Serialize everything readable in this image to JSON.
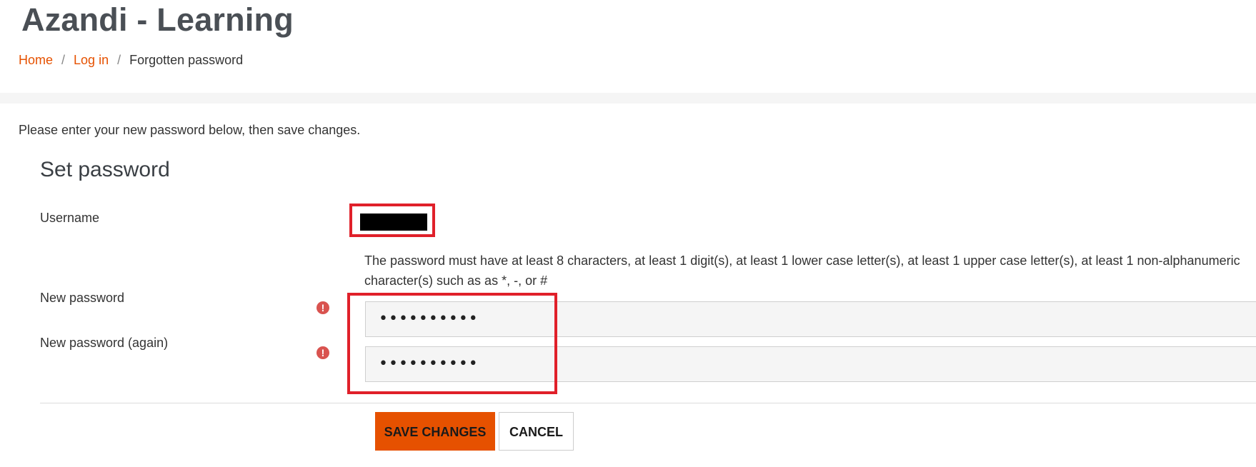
{
  "site": {
    "title": "Azandi - Learning"
  },
  "breadcrumb": {
    "items": [
      {
        "label": "Home"
      },
      {
        "label": "Log in"
      },
      {
        "label": "Forgotten password"
      }
    ],
    "separator": "/"
  },
  "form": {
    "intro": "Please enter your new password below, then save changes.",
    "legend": "Set password",
    "username": {
      "label": "Username",
      "value": "[redacted]"
    },
    "password_policy": "The password must have at least 8 characters, at least 1 digit(s), at least 1 lower case letter(s), at least 1 upper case letter(s), at least 1 non-alphanumeric character(s) such as as *, -, or #",
    "new_password": {
      "label": "New password",
      "value": "••••••••••",
      "required_icon": "exclamation-circle-icon"
    },
    "new_password_again": {
      "label": "New password (again)",
      "value": "••••••••••",
      "required_icon": "exclamation-circle-icon"
    },
    "required_glyph": "!",
    "buttons": {
      "save_label": "Save changes",
      "cancel_label": "Cancel"
    }
  },
  "colors": {
    "accent": "#e65100",
    "required": "#d9534f",
    "highlight": "#e0202a"
  }
}
